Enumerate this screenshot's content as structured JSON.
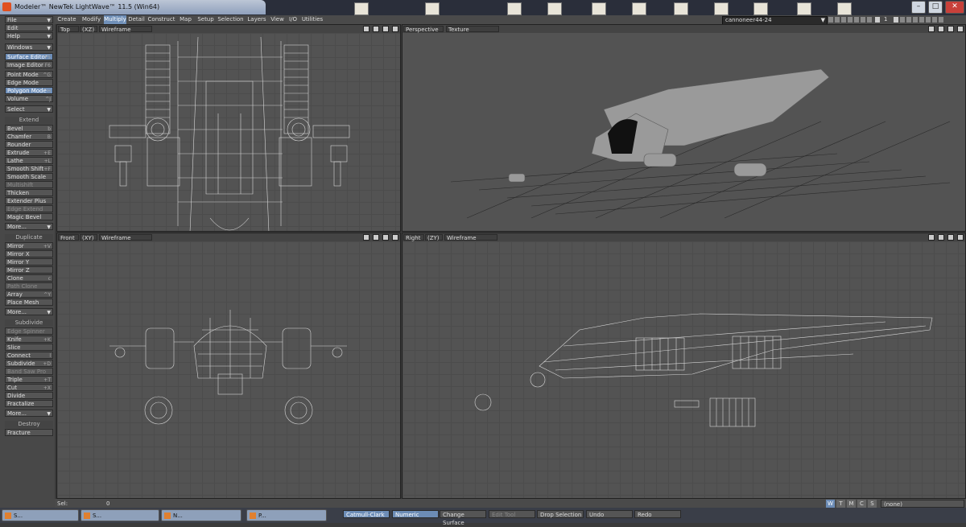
{
  "window": {
    "title": "Modeler™ NewTek LightWave™ 11.5 (Win64)"
  },
  "menubar_tabs": [
    {
      "label": "Create",
      "active": false
    },
    {
      "label": "Modify",
      "active": false
    },
    {
      "label": "Multiply",
      "active": true
    },
    {
      "label": "Detail",
      "active": false
    },
    {
      "label": "Construct",
      "active": false
    },
    {
      "label": "Map",
      "active": false
    },
    {
      "label": "Setup",
      "active": false
    },
    {
      "label": "Selection",
      "active": false
    },
    {
      "label": "Layers",
      "active": false
    },
    {
      "label": "View",
      "active": false
    },
    {
      "label": "I/O",
      "active": false
    },
    {
      "label": "Utilities",
      "active": false
    }
  ],
  "layer_selector": {
    "value": "cannoneer44-24",
    "layer_number": "1"
  },
  "left_panel": {
    "top_menus": [
      {
        "label": "File"
      },
      {
        "label": "Edit"
      },
      {
        "label": "Help"
      },
      {
        "label": "Windows"
      }
    ],
    "editors": [
      {
        "label": "Surface Editor",
        "shortcut": "F5",
        "selected": true
      },
      {
        "label": "Image Editor",
        "shortcut": "F6"
      }
    ],
    "modes": [
      {
        "label": "Point Mode",
        "shortcut": "^G"
      },
      {
        "label": "Edge Mode",
        "shortcut": ""
      },
      {
        "label": "Polygon Mode",
        "shortcut": "^H",
        "selected": true
      },
      {
        "label": "Volume",
        "shortcut": "^J"
      }
    ],
    "select_label": "Select",
    "extend_header": "Extend",
    "extend_items": [
      {
        "label": "Bevel",
        "shortcut": "b"
      },
      {
        "label": "Chamfer",
        "shortcut": "B"
      },
      {
        "label": "Rounder",
        "shortcut": ""
      },
      {
        "label": "Extrude",
        "shortcut": "+E"
      },
      {
        "label": "Lathe",
        "shortcut": "+L"
      },
      {
        "label": "Smooth Shift",
        "shortcut": "+F"
      },
      {
        "label": "Smooth Scale",
        "shortcut": ""
      },
      {
        "label": "Multishift",
        "shortcut": "",
        "dim": true
      },
      {
        "label": "Thicken",
        "shortcut": ""
      },
      {
        "label": "Extender Plus",
        "shortcut": ""
      },
      {
        "label": "Edge Extend",
        "shortcut": "",
        "dim": true
      },
      {
        "label": "Magic Bevel",
        "shortcut": ""
      }
    ],
    "more1": "More...",
    "duplicate_header": "Duplicate",
    "duplicate_items": [
      {
        "label": "Mirror",
        "shortcut": "+V"
      },
      {
        "label": "Mirror X",
        "shortcut": ""
      },
      {
        "label": "Mirror Y",
        "shortcut": ""
      },
      {
        "label": "Mirror Z",
        "shortcut": ""
      },
      {
        "label": "Clone",
        "shortcut": "c"
      },
      {
        "label": "Path Clone",
        "shortcut": "",
        "dim": true
      },
      {
        "label": "Array",
        "shortcut": "^Y"
      },
      {
        "label": "Place Mesh",
        "shortcut": ""
      }
    ],
    "more2": "More...",
    "subdivide_header": "Subdivide",
    "subdivide_items": [
      {
        "label": "Edge Spinner",
        "shortcut": "",
        "dim": true
      },
      {
        "label": "Knife",
        "shortcut": "+K"
      },
      {
        "label": "Slice",
        "shortcut": ""
      },
      {
        "label": "Connect",
        "shortcut": "l"
      },
      {
        "label": "Subdivide",
        "shortcut": "+D"
      },
      {
        "label": "Band Saw Pro",
        "shortcut": "",
        "dim": true
      },
      {
        "label": "Triple",
        "shortcut": "+T"
      },
      {
        "label": "Cut",
        "shortcut": "+X"
      },
      {
        "label": "Divide",
        "shortcut": ""
      },
      {
        "label": "Fractalize",
        "shortcut": ""
      }
    ],
    "more3": "More...",
    "destroy_header": "Destroy",
    "destroy_items": [
      {
        "label": "Fracture",
        "shortcut": ""
      }
    ]
  },
  "viewports": [
    {
      "view": "Top",
      "axis": "(XZ)",
      "mode": "Wireframe"
    },
    {
      "view": "Perspective",
      "axis": "",
      "mode": "Texture"
    },
    {
      "view": "Front",
      "axis": "(XY)",
      "mode": "Wireframe"
    },
    {
      "view": "Right",
      "axis": "(ZY)",
      "mode": "Wireframe"
    }
  ],
  "statusbar": {
    "sel_label": "Sel:",
    "sel_value": "0"
  },
  "bottom_toolbar": {
    "subpatch": "Catmull-Clark",
    "numeric": "Numeric",
    "change_surface": "Change Surface",
    "edit_tool": "Edit Tool",
    "drop_selection": "Drop Selection",
    "undo": "Undo",
    "redo": "Redo",
    "wtmcs": [
      "W",
      "T",
      "M",
      "C",
      "S"
    ],
    "surface_value": "(none)"
  },
  "taskbar": [
    {
      "label": "S..."
    },
    {
      "label": "S..."
    },
    {
      "label": "N..."
    },
    {
      "label": "P..."
    }
  ],
  "colors": {
    "accent": "#6c8cb6",
    "panel": "#484848",
    "viewport": "#535353"
  }
}
